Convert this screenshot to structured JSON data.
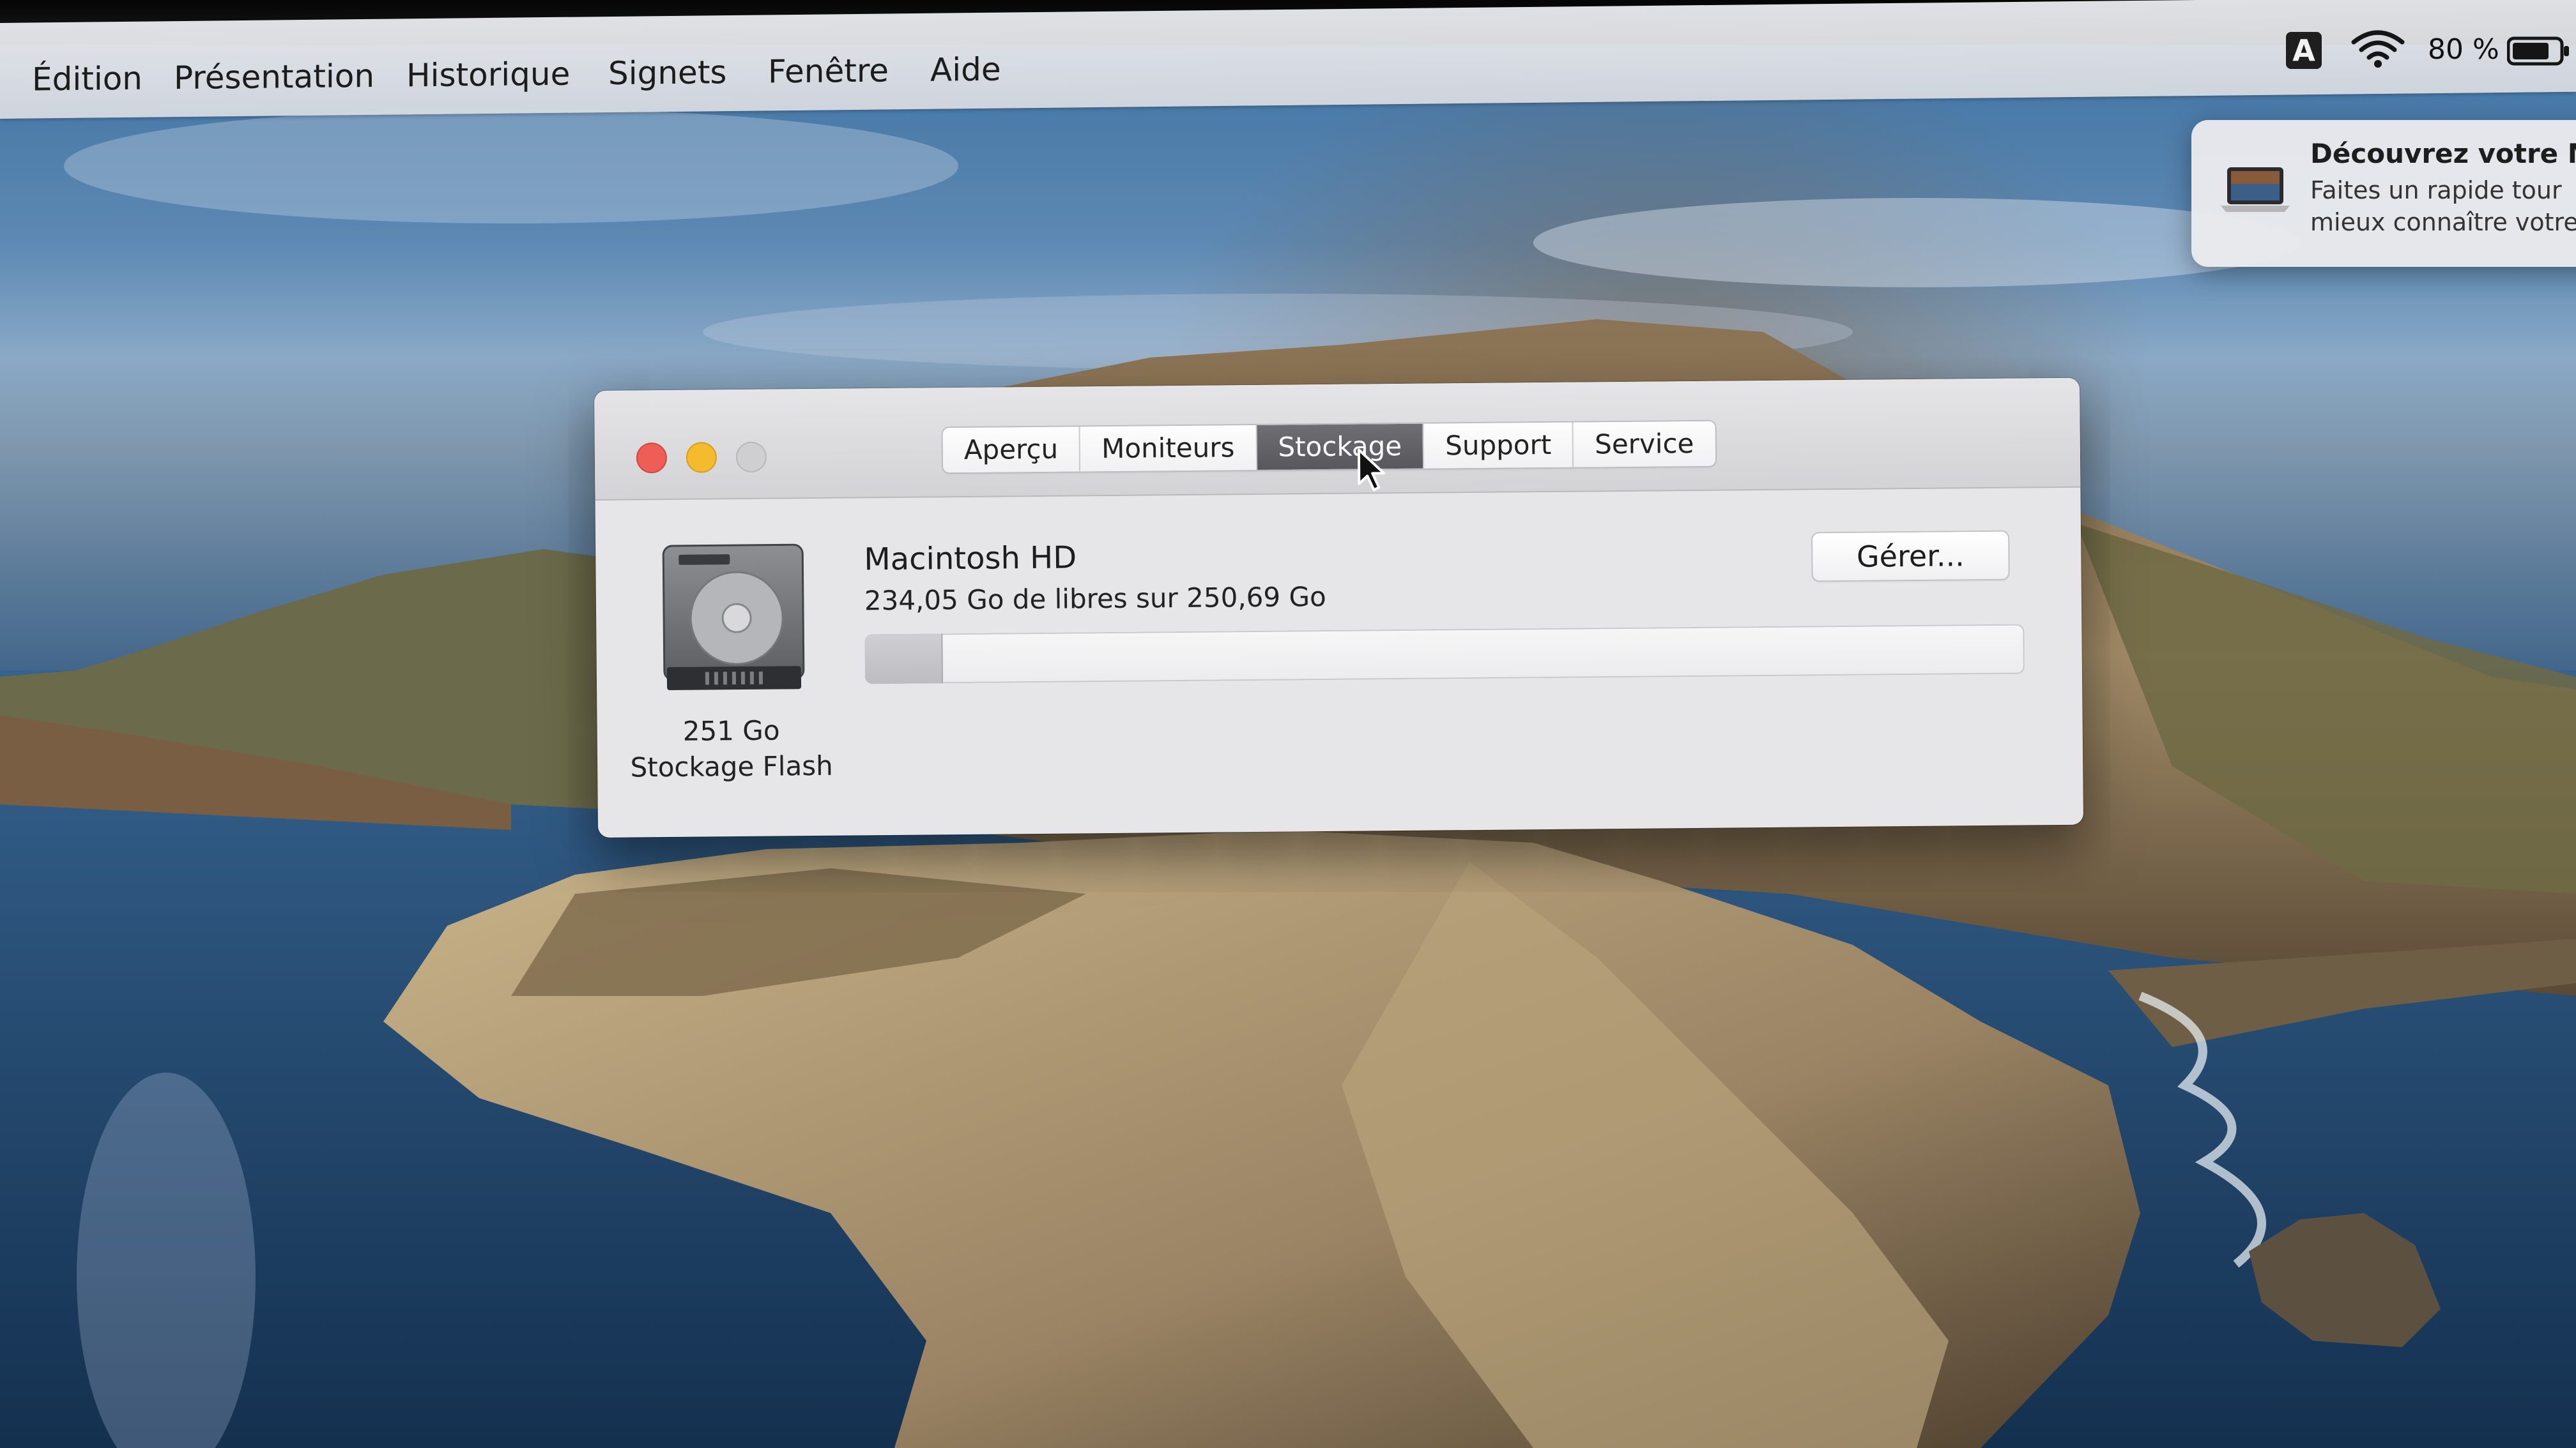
{
  "menubar": {
    "items": [
      "Édition",
      "Présentation",
      "Historique",
      "Signets",
      "Fenêtre",
      "Aide"
    ],
    "input_source": "A",
    "battery_text": "80 %",
    "battery_level": 0.8
  },
  "notification": {
    "title": "Découvrez votre Ma",
    "line1": "Faites un rapide tour",
    "line2": "mieux connaître votre"
  },
  "window": {
    "tabs": [
      {
        "label": "Aperçu",
        "selected": false
      },
      {
        "label": "Moniteurs",
        "selected": false
      },
      {
        "label": "Stockage",
        "selected": true
      },
      {
        "label": "Support",
        "selected": false
      },
      {
        "label": "Service",
        "selected": false
      }
    ],
    "disk": {
      "size_label": "251 Go",
      "type_label": "Stockage Flash"
    },
    "volume": {
      "name": "Macintosh HD",
      "free_text": "234,05 Go de libres sur 250,69 Go",
      "used_fraction": 0.066
    },
    "manage_button": "Gérer..."
  },
  "colors": {
    "close": "#ee5e57",
    "minimize": "#f4bb2f",
    "zoom": "#cfcfd2",
    "tab_selected": "#5f5f63"
  },
  "icons": [
    "wifi-icon",
    "battery-icon",
    "hard-drive-icon",
    "cursor-arrow-icon",
    "macbook-icon"
  ]
}
